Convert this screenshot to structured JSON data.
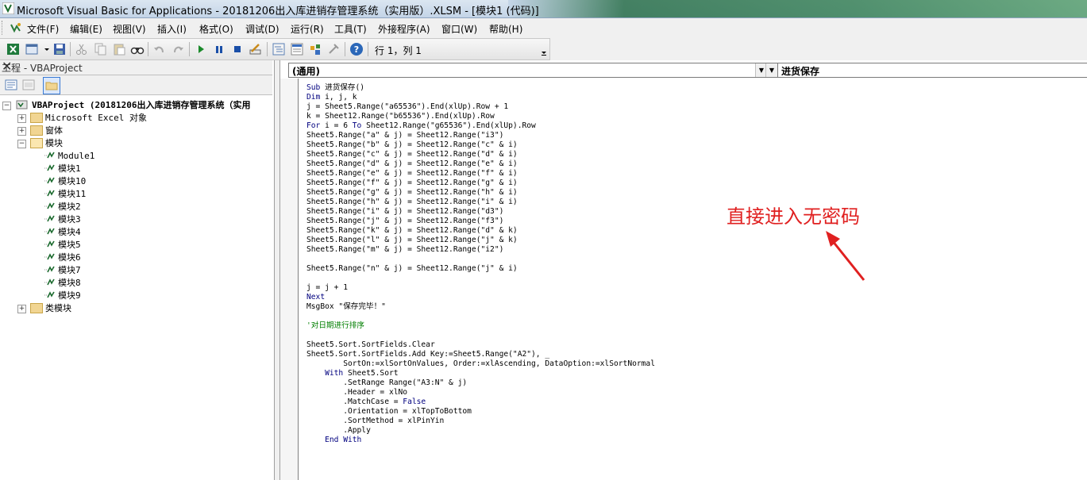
{
  "window": {
    "title": "Microsoft Visual Basic for Applications - 20181206出入库进销存管理系统（实用版）.XLSM - [模块1 (代码)]"
  },
  "menu": {
    "items": [
      {
        "label": "文件(F)"
      },
      {
        "label": "编辑(E)"
      },
      {
        "label": "视图(V)"
      },
      {
        "label": "插入(I)"
      },
      {
        "label": "格式(O)"
      },
      {
        "label": "调试(D)"
      },
      {
        "label": "运行(R)"
      },
      {
        "label": "工具(T)"
      },
      {
        "label": "外接程序(A)"
      },
      {
        "label": "窗口(W)"
      },
      {
        "label": "帮助(H)"
      }
    ]
  },
  "toolbar": {
    "position_text": "行 1，列 1"
  },
  "project": {
    "title": "工程 - VBAProject",
    "close": "✕",
    "tree": {
      "root": "VBAProject (20181206出入库进销存管理系统（实用",
      "excel_objects": "Microsoft Excel 对象",
      "forms": "窗体",
      "modules": "模块",
      "module_items": [
        "Module1",
        "模块1",
        "模块10",
        "模块11",
        "模块2",
        "模块3",
        "模块4",
        "模块5",
        "模块6",
        "模块7",
        "模块8",
        "模块9"
      ],
      "class_modules": "类模块"
    }
  },
  "code": {
    "object_combo": "(通用)",
    "proc_combo": "进货保存",
    "lines": {
      "l1a": "Sub",
      "l1b": " 进货保存()",
      "l2a": "Dim",
      "l2b": " i, j, k",
      "l3": "j = Sheet5.Range(\"a65536\").End(xlUp).Row + 1",
      "l4": "k = Sheet12.Range(\"b65536\").End(xlUp).Row",
      "l5a": "For",
      "l5b": " i = 6 ",
      "l5c": "To",
      "l5d": " Sheet12.Range(\"g65536\").End(xlUp).Row",
      "l6": "Sheet5.Range(\"a\" & j) = Sheet12.Range(\"i3\")",
      "l7": "Sheet5.Range(\"b\" & j) = Sheet12.Range(\"c\" & i)",
      "l8": "Sheet5.Range(\"c\" & j) = Sheet12.Range(\"d\" & i)",
      "l9": "Sheet5.Range(\"d\" & j) = Sheet12.Range(\"e\" & i)",
      "l10": "Sheet5.Range(\"e\" & j) = Sheet12.Range(\"f\" & i)",
      "l11": "Sheet5.Range(\"f\" & j) = Sheet12.Range(\"g\" & i)",
      "l12": "Sheet5.Range(\"g\" & j) = Sheet12.Range(\"h\" & i)",
      "l13": "Sheet5.Range(\"h\" & j) = Sheet12.Range(\"i\" & i)",
      "l14": "Sheet5.Range(\"i\" & j) = Sheet12.Range(\"d3\")",
      "l15": "Sheet5.Range(\"j\" & j) = Sheet12.Range(\"f3\")",
      "l16": "Sheet5.Range(\"k\" & j) = Sheet12.Range(\"d\" & k)",
      "l17": "Sheet5.Range(\"l\" & j) = Sheet12.Range(\"j\" & k)",
      "l18": "Sheet5.Range(\"m\" & j) = Sheet12.Range(\"i2\")",
      "l19": "Sheet5.Range(\"n\" & j) = Sheet12.Range(\"j\" & i)",
      "l20": "j = j + 1",
      "l21": "Next",
      "l22": "MsgBox \"保存完毕！\"",
      "l23": "'对日期进行排序",
      "l24": "Sheet5.Sort.SortFields.Clear",
      "l25": "Sheet5.Sort.SortFields.Add Key:=Sheet5.Range(\"A2\"), _",
      "l26": "        SortOn:=xlSortOnValues, Order:=xlAscending, DataOption:=xlSortNormal",
      "l27a": "    With",
      "l27b": " Sheet5.Sort",
      "l28": "        .SetRange Range(\"A3:N\" & j)",
      "l29": "        .Header = xlNo",
      "l30a": "        .MatchCase = ",
      "l30b": "False",
      "l31": "        .Orientation = xlTopToBottom",
      "l32": "        .SortMethod = xlPinYin",
      "l33": "        .Apply",
      "l34": "    End With"
    }
  },
  "annotation": {
    "text": "直接进入无密码",
    "color": "#e02020"
  }
}
